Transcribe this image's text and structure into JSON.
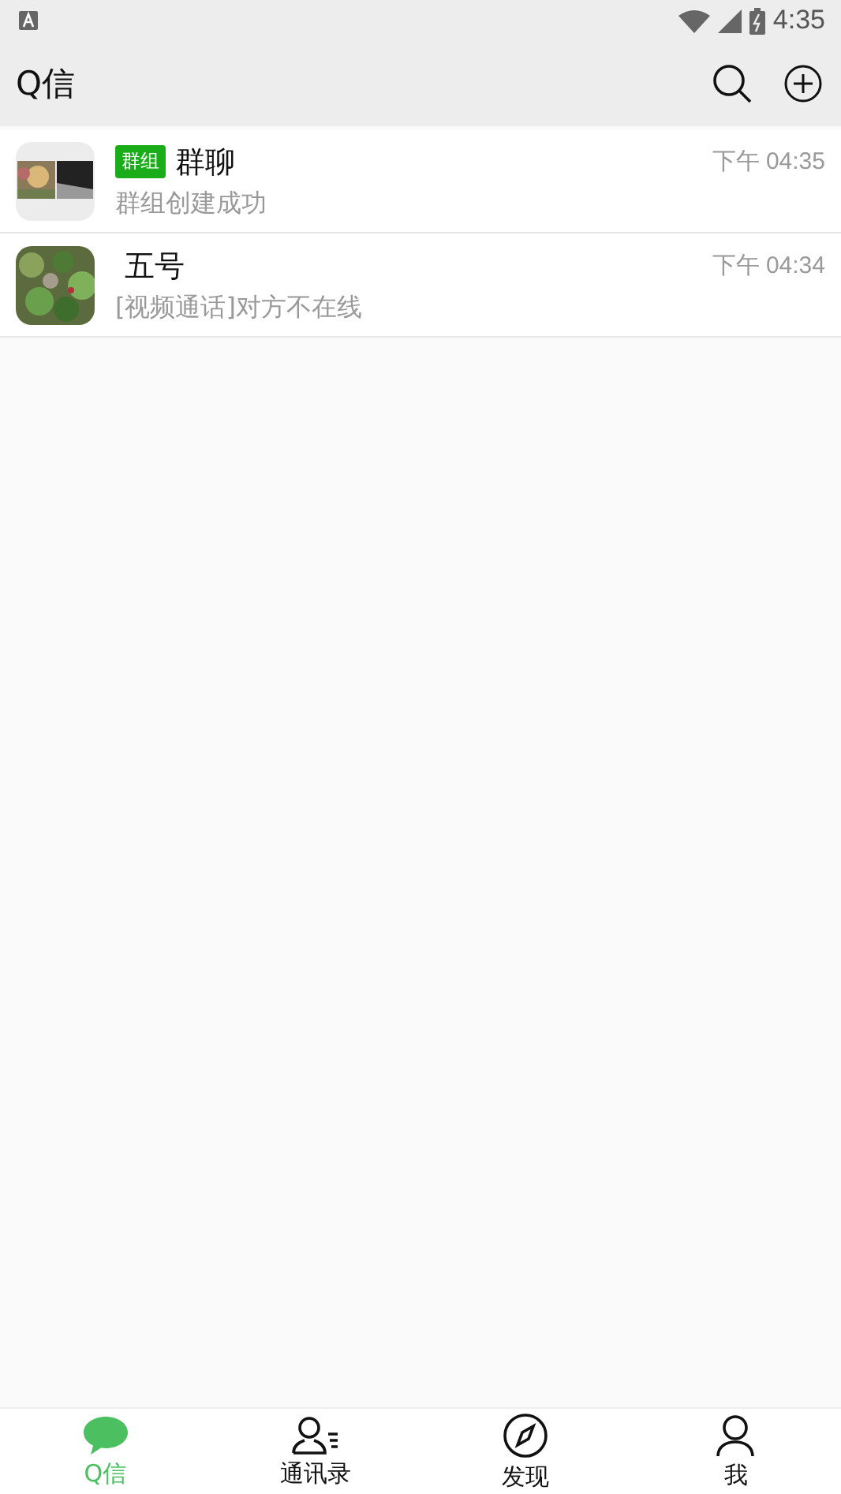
{
  "status_bar": {
    "time": "4:35"
  },
  "app_bar": {
    "title": "Q信"
  },
  "chats": [
    {
      "badge": "群组",
      "name": "群聊",
      "time": "下午 04:35",
      "preview": "群组创建成功",
      "kind": "group"
    },
    {
      "name": "五号",
      "time": "下午 04:34",
      "preview": "[视频通话]对方不在线",
      "kind": "single"
    }
  ],
  "tabs": [
    {
      "label": "Q信",
      "kind": "chat",
      "selected": true
    },
    {
      "label": "通讯录",
      "kind": "contacts",
      "selected": false
    },
    {
      "label": "发现",
      "kind": "discover",
      "selected": false
    },
    {
      "label": "我",
      "kind": "me",
      "selected": false
    }
  ]
}
